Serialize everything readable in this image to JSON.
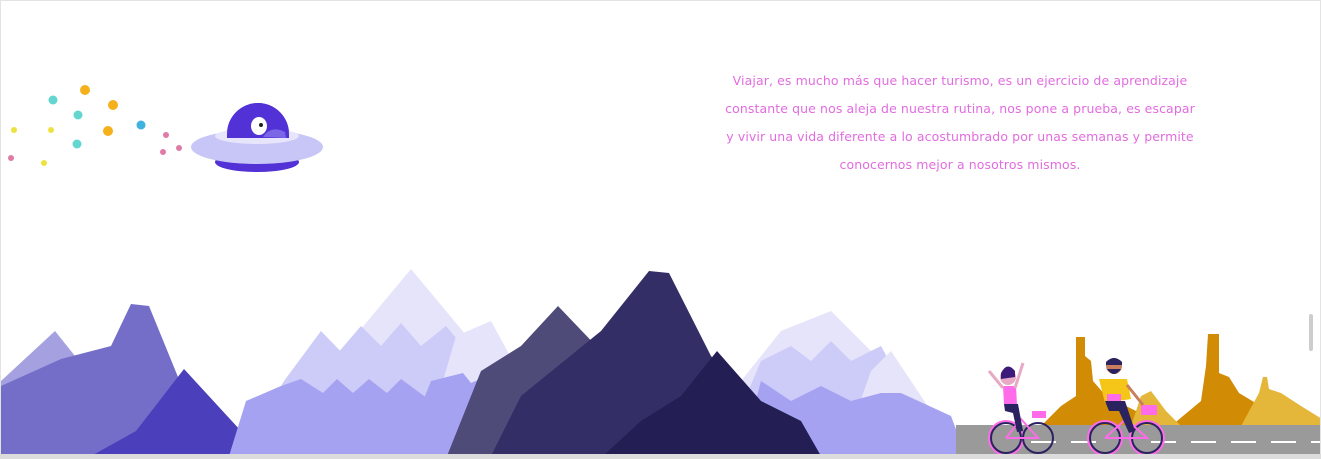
{
  "intro": {
    "text": "Viajar, es mucho más que hacer turismo, es un ejercicio de aprendizaje constante que nos aleja de nuestra rutina, nos pone a prueba, es escapar y vivir una vida diferente a lo acostumbrado por unas semanas y permite conocernos mejor a nosotros mismos."
  },
  "colors": {
    "text": "#e26ce0",
    "mountain_dark": "#231f55",
    "mountain_mid": "#4b3fbb",
    "mountain_light": "#cdcbf8",
    "desert": "#d28b05",
    "road": "#9a9a9a"
  },
  "icons": {
    "ufo": "ufo-with-alien",
    "cyclists": "two-cyclists"
  }
}
